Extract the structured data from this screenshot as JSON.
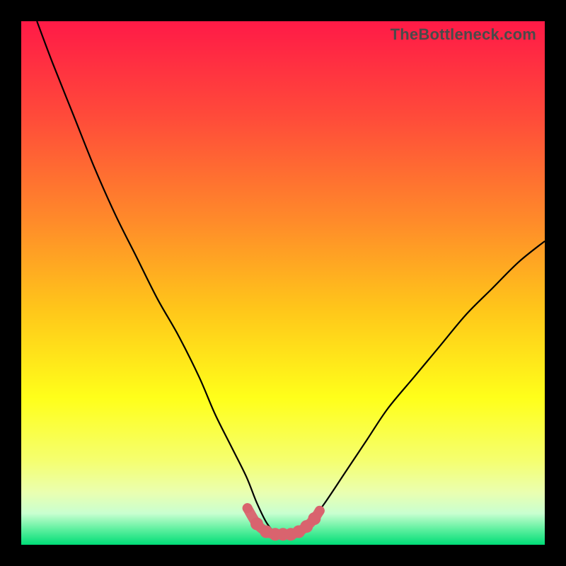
{
  "watermark": {
    "text": "TheBottleneck.com"
  },
  "chart_data": {
    "type": "line",
    "title": "",
    "xlabel": "",
    "ylabel": "",
    "xlim": [
      0,
      100
    ],
    "ylim": [
      0,
      100
    ],
    "series": [
      {
        "name": "curve",
        "x": [
          3,
          6,
          10,
          14,
          18,
          22,
          26,
          30,
          34,
          37,
          40,
          43,
          45,
          47,
          49,
          51,
          53,
          55,
          58,
          62,
          66,
          70,
          75,
          80,
          85,
          90,
          95,
          100
        ],
        "y": [
          100,
          92,
          82,
          72,
          63,
          55,
          47,
          40,
          32,
          25,
          19,
          13,
          8,
          4,
          2,
          2,
          2,
          4,
          8,
          14,
          20,
          26,
          32,
          38,
          44,
          49,
          54,
          58
        ]
      }
    ],
    "dots": {
      "x": [
        43.2,
        45.0,
        46.8,
        48.5,
        50.0,
        51.5,
        53.0,
        54.5,
        56.0,
        57.0
      ],
      "y": [
        7.0,
        4.0,
        2.5,
        2.0,
        2.0,
        2.0,
        2.5,
        3.5,
        5.0,
        6.5
      ]
    },
    "gradient_stops": [
      {
        "offset": 0,
        "color": "#ff1a47"
      },
      {
        "offset": 0.18,
        "color": "#ff4a3a"
      },
      {
        "offset": 0.38,
        "color": "#ff8a2a"
      },
      {
        "offset": 0.55,
        "color": "#ffc61a"
      },
      {
        "offset": 0.72,
        "color": "#ffff1a"
      },
      {
        "offset": 0.84,
        "color": "#f5ff70"
      },
      {
        "offset": 0.9,
        "color": "#eaffb0"
      },
      {
        "offset": 0.94,
        "color": "#c9ffd0"
      },
      {
        "offset": 0.97,
        "color": "#60f0a0"
      },
      {
        "offset": 1.0,
        "color": "#00dd77"
      }
    ],
    "colors": {
      "curve": "#000000",
      "dots": "#d9636e"
    }
  }
}
